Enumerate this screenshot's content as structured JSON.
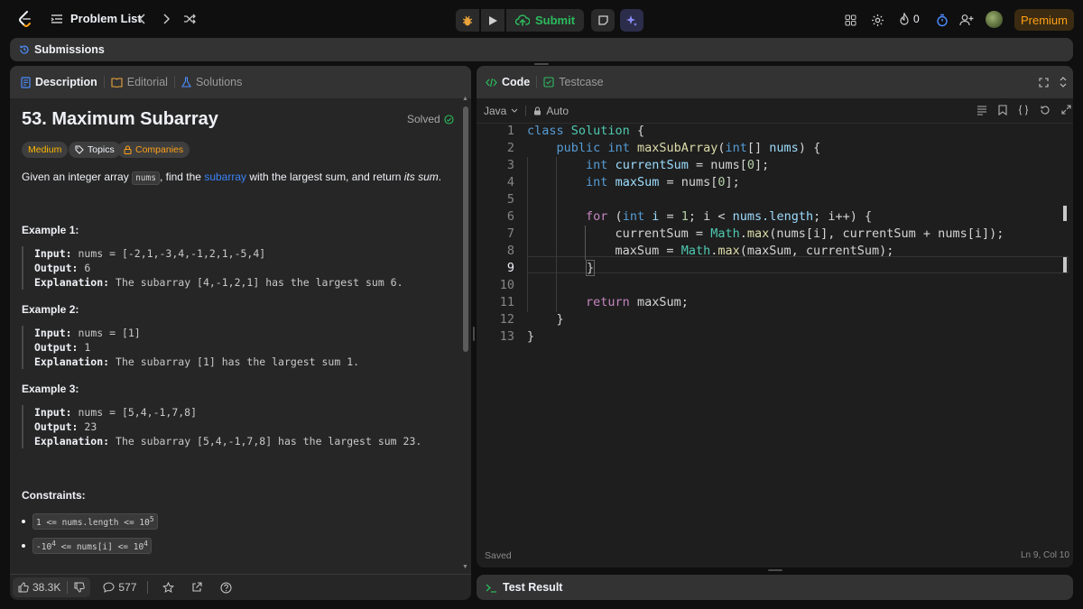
{
  "topbar": {
    "problem_list_label": "Problem List",
    "submit_label": "Submit",
    "streak_count": "0",
    "premium_label": "Premium"
  },
  "submissions_bar": {
    "label": "Submissions"
  },
  "left_panel": {
    "tabs": [
      "Description",
      "Editorial",
      "Solutions"
    ],
    "title": "53. Maximum Subarray",
    "solved_label": "Solved",
    "tags": [
      "Medium",
      "Topics",
      "Companies"
    ],
    "description": {
      "part1": "Given an integer array ",
      "code": "nums",
      "part2": ", find the ",
      "link": "subarray",
      "part3": " with the largest sum, and return ",
      "em": "its sum",
      "part4": "."
    },
    "examples": [
      {
        "heading": "Example 1:",
        "input": "nums = [-2,1,-3,4,-1,2,1,-5,4]",
        "output": "6",
        "explanation": "The subarray [4,-1,2,1] has the largest sum 6."
      },
      {
        "heading": "Example 2:",
        "input": "nums = [1]",
        "output": "1",
        "explanation": "The subarray [1] has the largest sum 1."
      },
      {
        "heading": "Example 3:",
        "input": "nums = [5,4,-1,7,8]",
        "output": "23",
        "explanation": "The subarray [5,4,-1,7,8] has the largest sum 23."
      }
    ],
    "labels": {
      "input": "Input:",
      "output": "Output:",
      "explanation": "Explanation:"
    },
    "constraints_heading": "Constraints:",
    "constraints": [
      {
        "text": "1 <= nums.length <= 10",
        "sup": "5",
        "prefix": "",
        "prefix_sup": ""
      },
      {
        "prefix": "-10",
        "prefix_sup": "4",
        "text": " <= nums[i] <= 10",
        "sup": "4"
      }
    ],
    "likes": "38.3K",
    "comments": "577"
  },
  "right_panel": {
    "tabs": [
      "Code",
      "Testcase"
    ],
    "language": "Java",
    "mode": "Auto",
    "status_left": "Saved",
    "status_right": "Ln 9, Col 10",
    "code_lines": [
      "class Solution {",
      "    public int maxSubArray(int[] nums) {",
      "        int currentSum = nums[0];",
      "        int maxSum = nums[0];",
      "",
      "        for (int i = 1; i < nums.length; i++) {",
      "            currentSum = Math.max(nums[i], currentSum + nums[i]);",
      "            maxSum = Math.max(maxSum, currentSum);",
      "        }",
      "",
      "        return maxSum;",
      "    }",
      "}"
    ],
    "current_line": 9
  },
  "test_result": {
    "label": "Test Result"
  },
  "colors": {
    "accent_orange": "#ffa116",
    "green": "#2cbb5d",
    "medium": "#ffb800",
    "link_blue": "#3b82f6"
  }
}
